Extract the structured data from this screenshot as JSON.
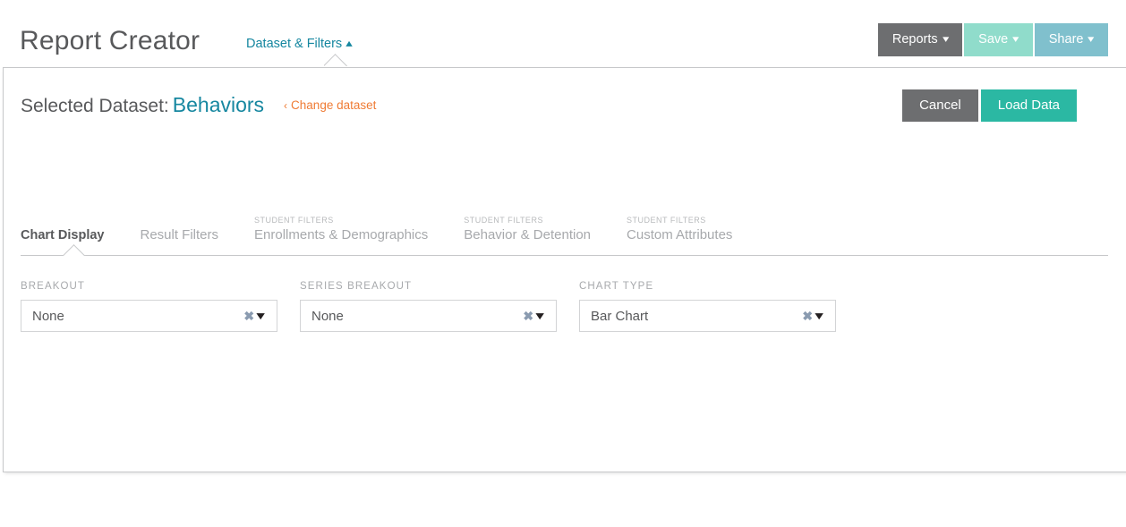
{
  "header": {
    "app_title": "Report Creator",
    "dataset_filters_link": "Dataset & Filters",
    "dataset_filters_chevron": "chevron-up-icon",
    "buttons": [
      {
        "label": "Reports",
        "color": "#6d6e70",
        "caret": "chevron-down-icon"
      },
      {
        "label": "Save",
        "color": "#90dccb",
        "caret": "chevron-down-icon"
      },
      {
        "label": "Share",
        "color": "#80c0cd",
        "caret": "chevron-down-icon"
      }
    ]
  },
  "panel": {
    "dataset": {
      "label": "Selected Dataset:",
      "value": "Behaviors",
      "change_link": "Change dataset",
      "change_link_arrow": "‹"
    },
    "actions": {
      "cancel_label": "Cancel",
      "load_data_label": "Load Data",
      "cancel_color": "#6d6e70",
      "load_data_color": "#2bb8a3"
    },
    "tabs": [
      {
        "sup": "",
        "label": "Chart Display",
        "active": true
      },
      {
        "sup": "",
        "label": "Result Filters",
        "active": false
      },
      {
        "sup": "STUDENT FILTERS",
        "label": "Enrollments & Demographics",
        "active": false
      },
      {
        "sup": "STUDENT FILTERS",
        "label": "Behavior & Detention",
        "active": false
      },
      {
        "sup": "STUDENT FILTERS",
        "label": "Custom Attributes",
        "active": false
      }
    ],
    "fields": [
      {
        "label": "BREAKOUT",
        "value": "None",
        "clear_icon": "clear-x-icon",
        "caret_icon": "chevron-down-icon"
      },
      {
        "label": "SERIES BREAKOUT",
        "value": "None",
        "clear_icon": "clear-x-icon",
        "caret_icon": "chevron-down-icon"
      },
      {
        "label": "CHART TYPE",
        "value": "Bar Chart",
        "clear_icon": "clear-x-icon",
        "caret_icon": "chevron-down-icon"
      }
    ]
  },
  "colors": {
    "accent_teal": "#1687a0",
    "accent_orange": "#ef7b34",
    "primary_green": "#2bb8a3",
    "text_gray": "#58595b",
    "muted_gray": "#a7a9ac",
    "border_gray": "#c7c8ca"
  }
}
